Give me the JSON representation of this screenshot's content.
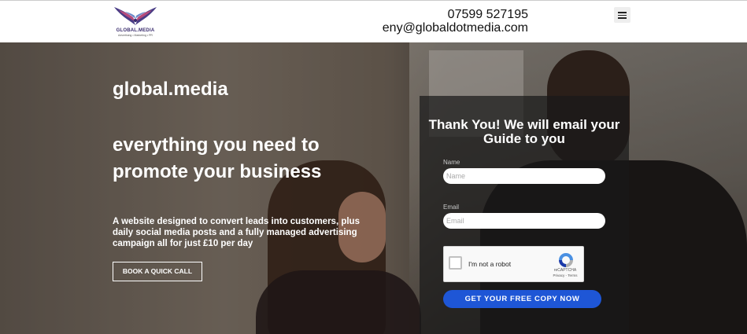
{
  "header": {
    "logo": {
      "name": "GLOBAL.MEDIA",
      "tagline": "Advertising • Marketing • PR",
      "icon": "winged-logo-icon"
    },
    "phone": "07599 527195",
    "email": "eny@globaldotmedia.com",
    "menu_icon": "hamburger-menu-icon"
  },
  "hero": {
    "brand": "global.media",
    "headline": "everything you need to promote your business",
    "description": "A website designed to convert leads into customers, plus daily social media posts and a fully managed advertising campaign all for just £10 per day",
    "cta_label": "BOOK A QUICK CALL"
  },
  "form": {
    "title": "Thank You! We will email your Guide to you",
    "name_label": "Name",
    "name_placeholder": "Name",
    "email_label": "Email",
    "email_placeholder": "Email",
    "recaptcha": {
      "label": "I'm not a robot",
      "brand": "reCAPTCHA",
      "terms": "Privacy - Terms"
    },
    "submit_label": "GET YOUR FREE COPY NOW"
  },
  "colors": {
    "accent": "#1e56d6",
    "logo": "#3a2d6e"
  }
}
